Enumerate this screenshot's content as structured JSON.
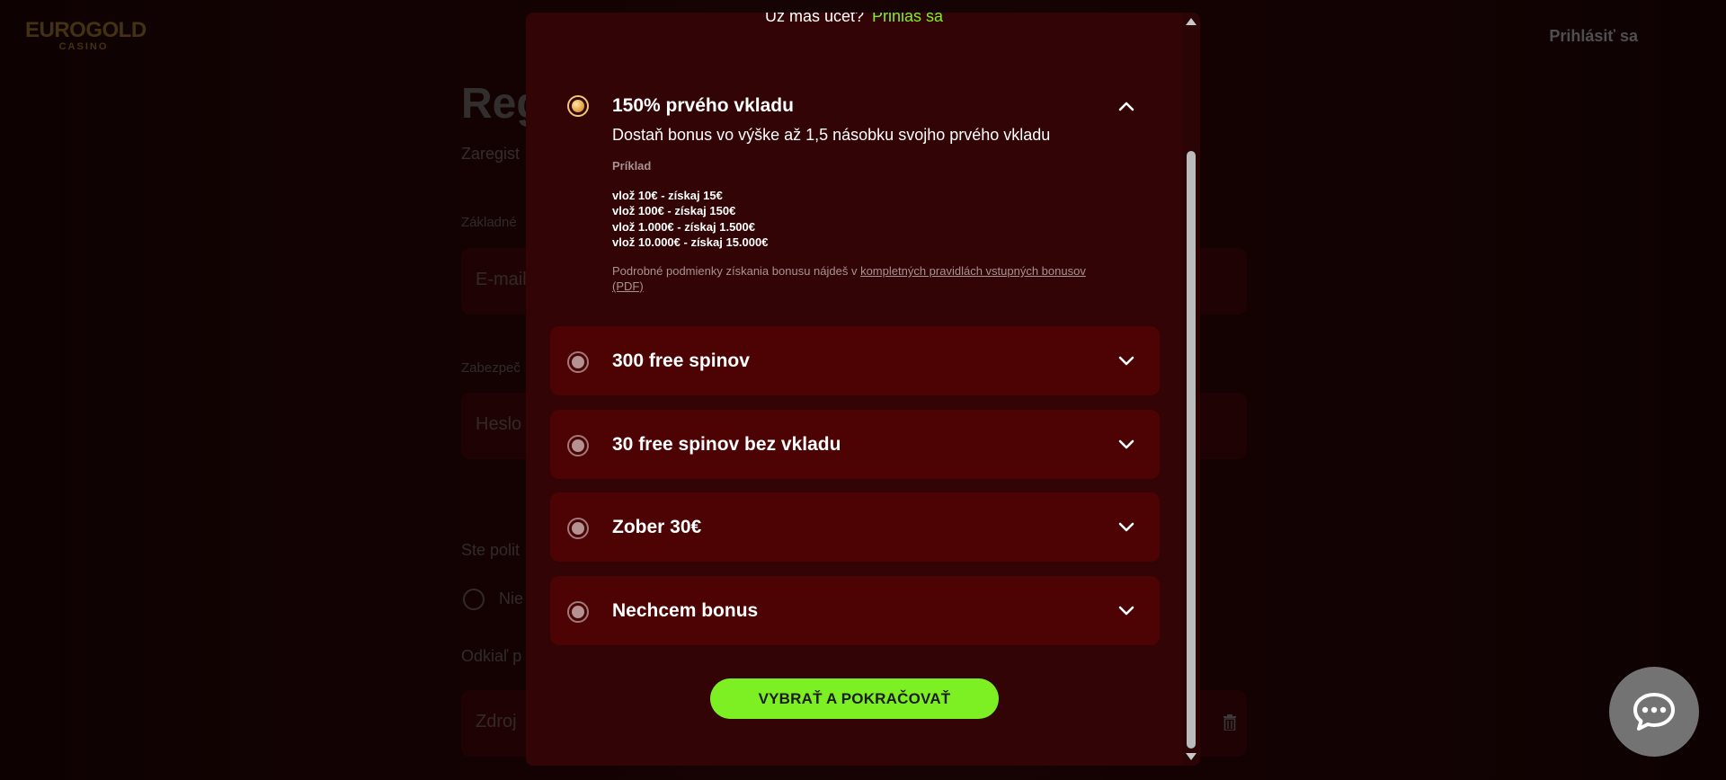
{
  "header": {
    "logo_line1": "EUROGOLD",
    "logo_line2": "CASINO",
    "login_link": "Prihlásiť sa"
  },
  "background_form": {
    "title": "Reg",
    "subtitle": "Zaregist",
    "section_basic": "Základné",
    "email_placeholder": "E-mail",
    "section_secure": "Zabezpeč",
    "password_placeholder": "Heslo",
    "politics_question": "Ste polit",
    "radio_no": "Nie",
    "source_question": "Odkiaľ p",
    "source_placeholder": "Zdroj"
  },
  "modal": {
    "have_account": "Už máš účet?",
    "login_link": "Prihlás sa",
    "options": [
      {
        "title": "150% prvého vkladu",
        "expanded": true,
        "selected": true,
        "description": "Dostaň bonus vo výške až 1,5 násobku svojho prvého vkladu",
        "example_label": "Príklad",
        "examples": [
          "vlož 10€ - získaj 15€",
          "vlož 100€ - získaj 150€",
          "vlož 1.000€ - získaj 1.500€",
          "vlož 10.000€ - získaj 15.000€"
        ],
        "terms_prefix": "Podrobné podmienky získania bonusu nájdeš v ",
        "terms_link": "kompletných pravidlách vstupných bonusov (PDF)"
      },
      {
        "title": "300 free spinov",
        "expanded": false,
        "selected": false
      },
      {
        "title": "30 free spinov bez vkladu",
        "expanded": false,
        "selected": false
      },
      {
        "title": "Zober 30€",
        "expanded": false,
        "selected": false
      },
      {
        "title": "Nechcem bonus",
        "expanded": false,
        "selected": false
      }
    ],
    "cta_label": "VYBRAŤ A POKRAČOVAŤ"
  },
  "colors": {
    "accent_green": "#7cf022",
    "modal_bg": "#320405",
    "option_bg": "#4d0304",
    "selected_radio": "#e2a64a"
  },
  "icons": {
    "chevron_up": "chevron-up-icon",
    "chevron_down": "chevron-down-icon",
    "chat": "chat-bubble-icon",
    "trash": "trash-icon"
  }
}
